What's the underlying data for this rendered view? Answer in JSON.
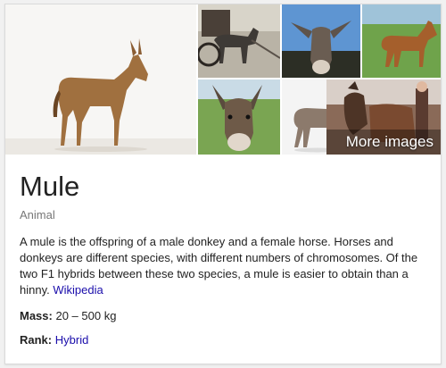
{
  "panel": {
    "title": "Mule",
    "subtitle": "Animal",
    "description": "A mule is the offspring of a male donkey and a female horse. Horses and donkeys are different species, with different numbers of chromosomes. Of the two F1 hybrids between these two species, a mule is easier to obtain than a hinny.",
    "source_link": "Wikipedia",
    "facts": [
      {
        "label": "Mass:",
        "value": "20 – 500 kg",
        "is_link": false
      },
      {
        "label": "Rank:",
        "value": "Hybrid",
        "is_link": true
      }
    ]
  },
  "gallery": {
    "more_images_label": "More images",
    "images": [
      {
        "icon": "mule-standing-photo"
      },
      {
        "icon": "donkey-cart-photo"
      },
      {
        "icon": "donkey-head-sky-photo"
      },
      {
        "icon": "mule-grass-photo"
      },
      {
        "icon": "donkey-face-photo"
      },
      {
        "icon": "donkey-standing-photo"
      },
      {
        "icon": "mules-people-photo"
      }
    ]
  },
  "colors": {
    "link": "#1a0dab",
    "title": "#222222",
    "subtitle": "#777777"
  }
}
